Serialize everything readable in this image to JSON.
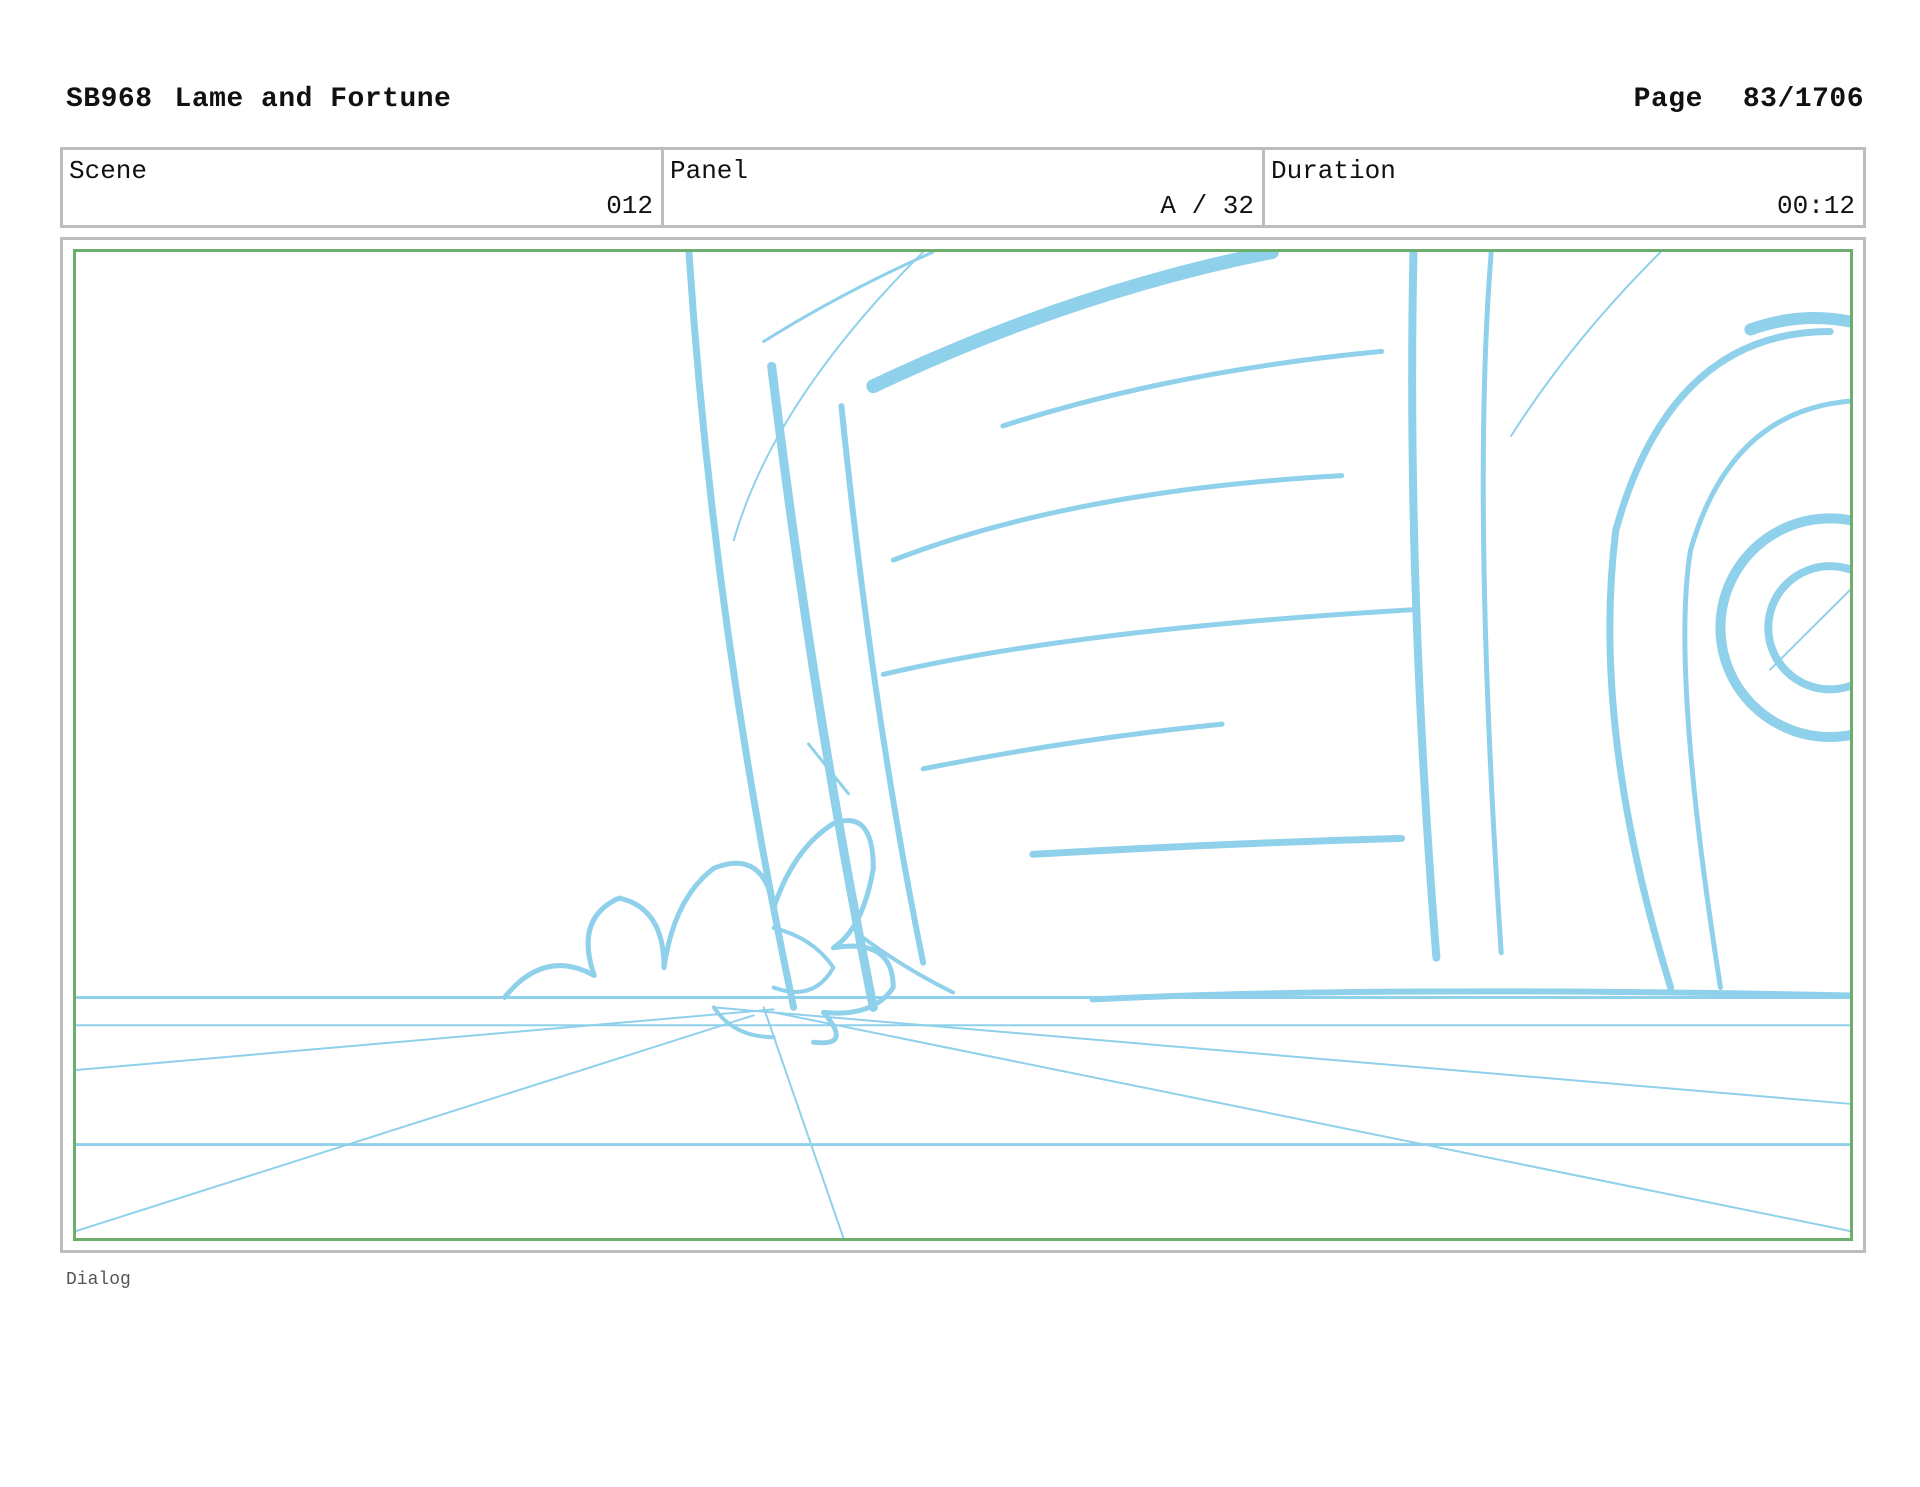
{
  "header": {
    "code": "SB968",
    "title": "Lame and Fortune",
    "page_label": "Page",
    "page_number": "83/1706"
  },
  "info": {
    "scene_label": "Scene",
    "scene_value": "012",
    "panel_label": "Panel",
    "panel_value": "A / 32",
    "duration_label": "Duration",
    "duration_value": "00:12"
  },
  "dialog": {
    "label": "Dialog"
  },
  "colors": {
    "sketch": "#8fd0ea",
    "safe_frame": "#6dae6d",
    "frame_border": "#bdbdbd"
  }
}
